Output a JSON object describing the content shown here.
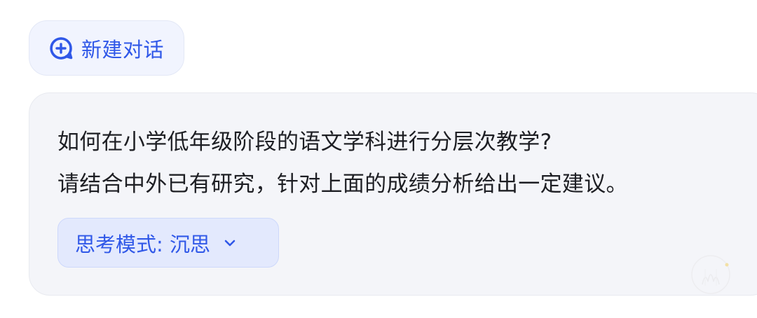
{
  "new_chat": {
    "label": "新建对话",
    "icon": "chat-plus-icon"
  },
  "message": {
    "lines": [
      "如何在小学低年级阶段的语文学科进行分层次教学?",
      "请结合中外已有研究，针对上面的成绩分析给出一定建议。"
    ]
  },
  "thinking_mode": {
    "label": "思考模式: 沉思",
    "icon": "chevron-down-icon"
  },
  "colors": {
    "accent": "#3058e8",
    "button_bg": "#f1f4fe",
    "card_bg": "#f4f5f9",
    "mode_bg": "#e3e9fd",
    "text": "#1e1f24"
  }
}
